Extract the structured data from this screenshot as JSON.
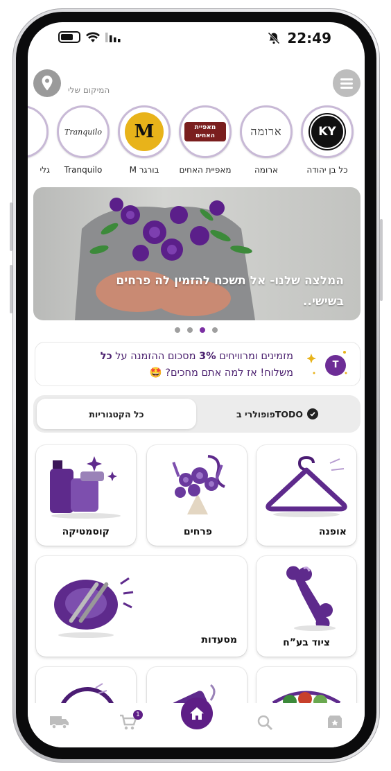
{
  "status": {
    "time": "22:49"
  },
  "header": {
    "location_label": "המיקום שלי"
  },
  "stores": [
    {
      "name": "כל בן יהודה",
      "logo": "KY"
    },
    {
      "name": "ארומה",
      "logo": "ארומה"
    },
    {
      "name": "מאפיית האחים",
      "logo": "מאפיית האחים"
    },
    {
      "name": "M בורגר",
      "logo": "M"
    },
    {
      "name": "Tranquilo",
      "logo": "Tranquilo"
    },
    {
      "name": "גלי",
      "logo": ""
    }
  ],
  "banner": {
    "text": "המלצה שלנו- אל תשכח להזמין לה פרחים בשישי.."
  },
  "promo": {
    "line1": "מזמינים ומרוויחים",
    "pct": "3%",
    "line2": "מסכום ההזמנה על",
    "strong": "כל",
    "line3": "משלוח! אז למה אתם מחכים?",
    "emoji": "🤩",
    "badge": "T"
  },
  "tabs": {
    "popular": "פופולרי בTODO",
    "all": "כל הקטגוריות"
  },
  "categories": [
    {
      "label": "אופנה"
    },
    {
      "label": "פרחים"
    },
    {
      "label": "קוסמטיקה"
    },
    {
      "label": "ציוד בע”ח"
    },
    {
      "label": "מסעדות"
    }
  ],
  "nav": {
    "cart_count": "1"
  },
  "colors": {
    "brand": "#5e1e86",
    "accent": "#7b2fa3"
  }
}
